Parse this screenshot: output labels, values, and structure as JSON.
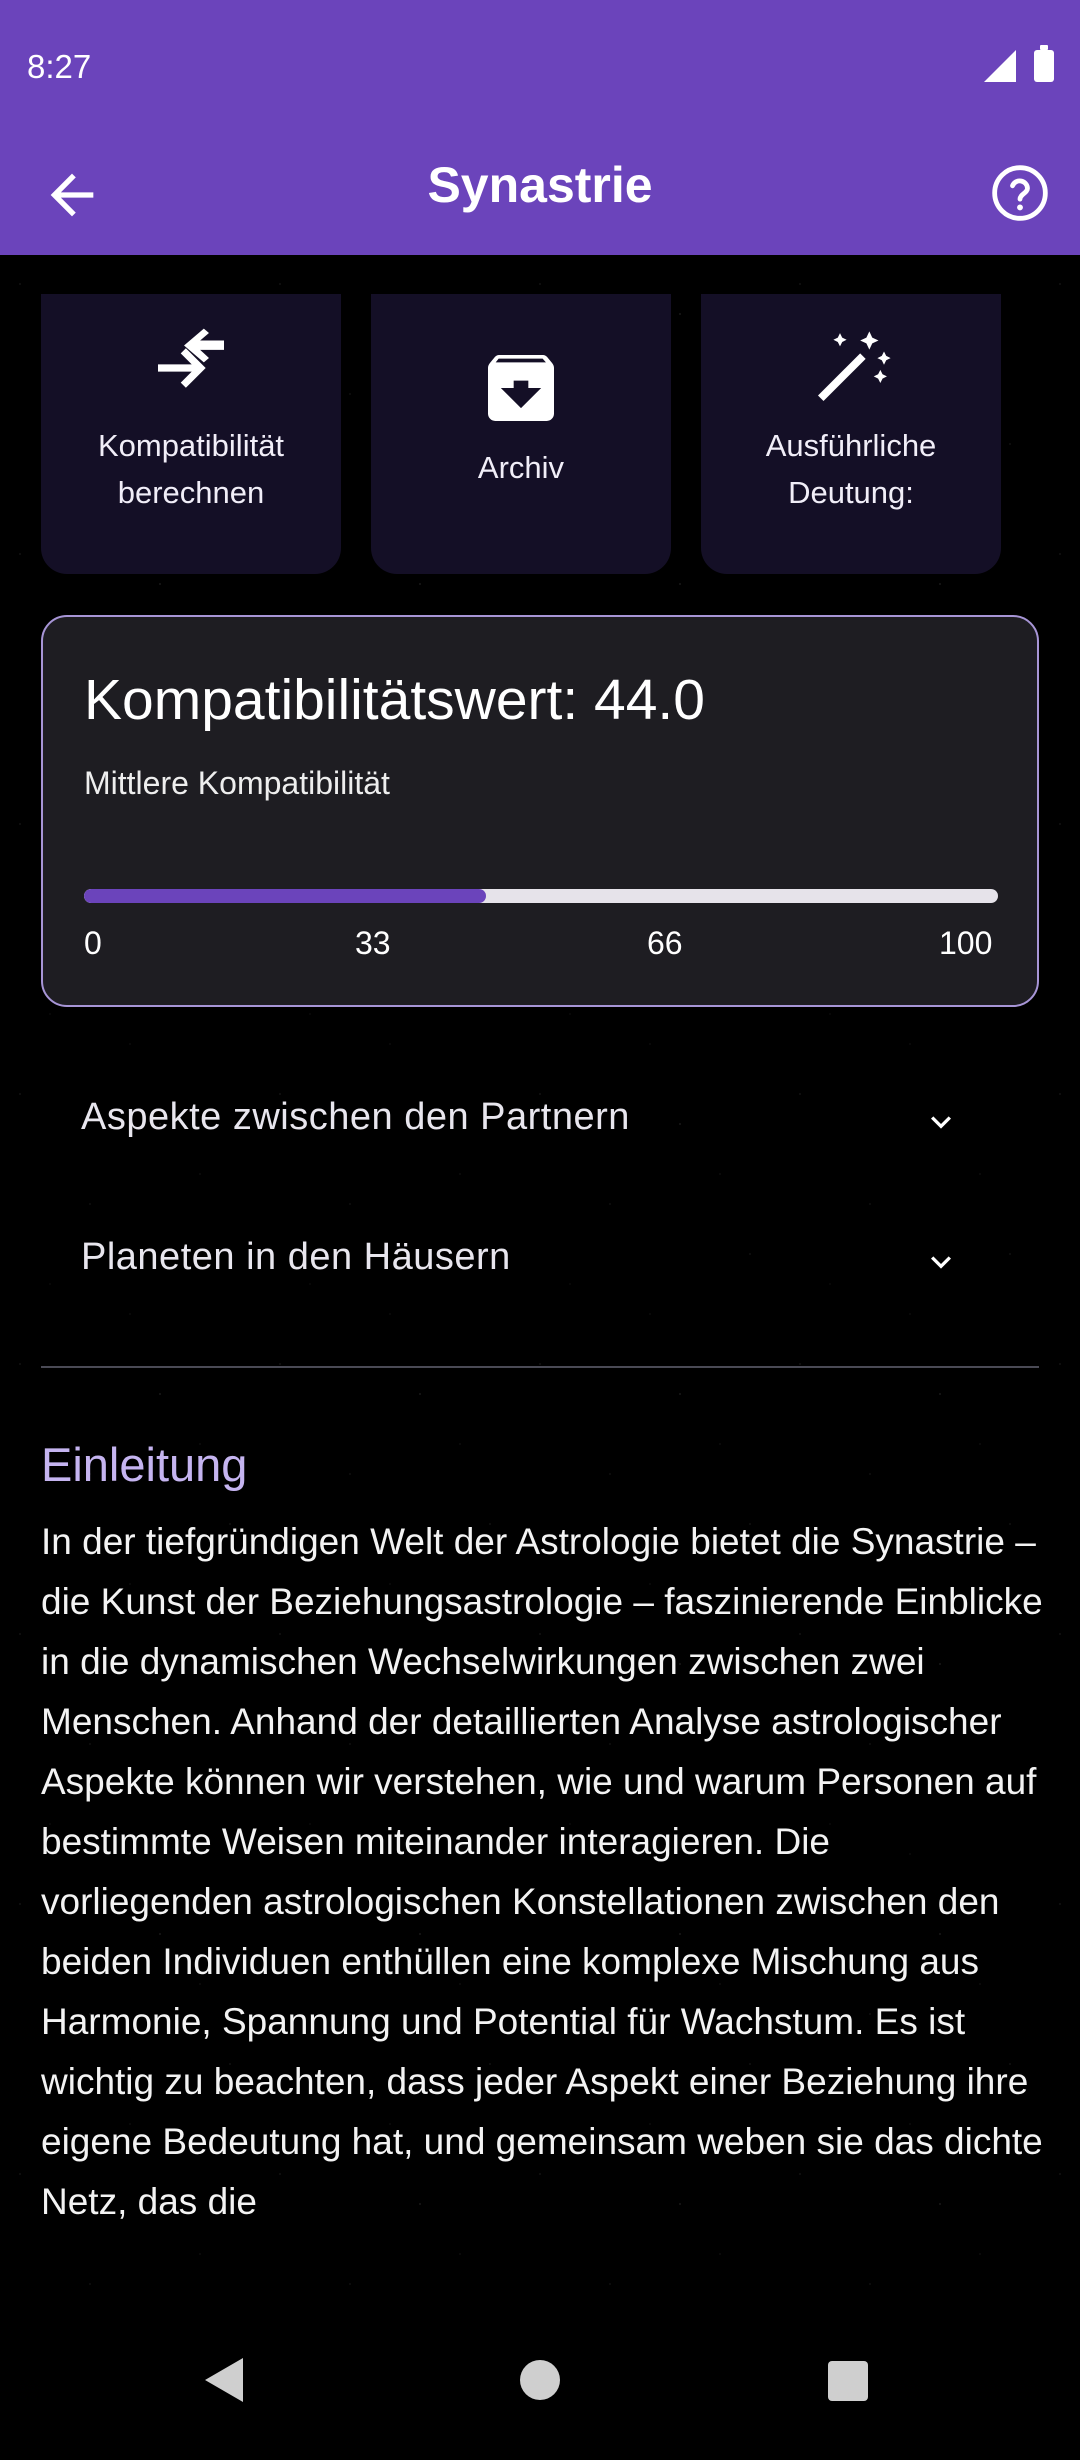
{
  "status_bar": {
    "time": "8:27"
  },
  "app_bar": {
    "title": "Synastrie",
    "back_icon": "arrow-left-icon",
    "help_icon": "help-circle-icon"
  },
  "actions": [
    {
      "label_line1": "Kompatibilität",
      "label_line2": "berechnen",
      "icon": "compare-arrows-icon"
    },
    {
      "label_line1": "Archiv",
      "icon": "archive-icon"
    },
    {
      "label_line1": "Ausführliche",
      "label_line2": "Deutung:",
      "icon": "magic-wand-icon"
    }
  ],
  "score_card": {
    "title": "Kompatibilitätswert: 44.0",
    "subtitle": "Mittlere Kompatibilität",
    "value": 44.0,
    "max": 100,
    "ticks": [
      "0",
      "33",
      "66",
      "100"
    ],
    "bar_color": "#6b44bb"
  },
  "sections": [
    {
      "label": "Aspekte zwischen den Partnern"
    },
    {
      "label": "Planeten in den Häusern"
    }
  ],
  "intro": {
    "heading": "Einleitung",
    "text": "In der tiefgründigen Welt der Astrologie bietet die Synastrie – die Kunst der Beziehungsastrologie – faszinierende Einblicke in die dynamischen Wechselwirkungen zwischen zwei Menschen. Anhand der detaillierten Analyse astrologischer Aspekte können wir verstehen, wie und warum Personen auf bestimmte Weisen miteinander interagieren. Die vorliegenden astrologischen Konstellationen zwischen den beiden Individuen enthüllen eine komplexe Mischung aus Harmonie, Spannung und Potential für Wachstum. Es ist wichtig zu beachten, dass jeder Aspekt einer Beziehung ihre eigene Bedeutung hat, und gemeinsam weben sie das dichte Netz, das die"
  },
  "colors": {
    "primary": "#6b44bb",
    "accent": "#c5b4f0",
    "card": "#140f26"
  }
}
